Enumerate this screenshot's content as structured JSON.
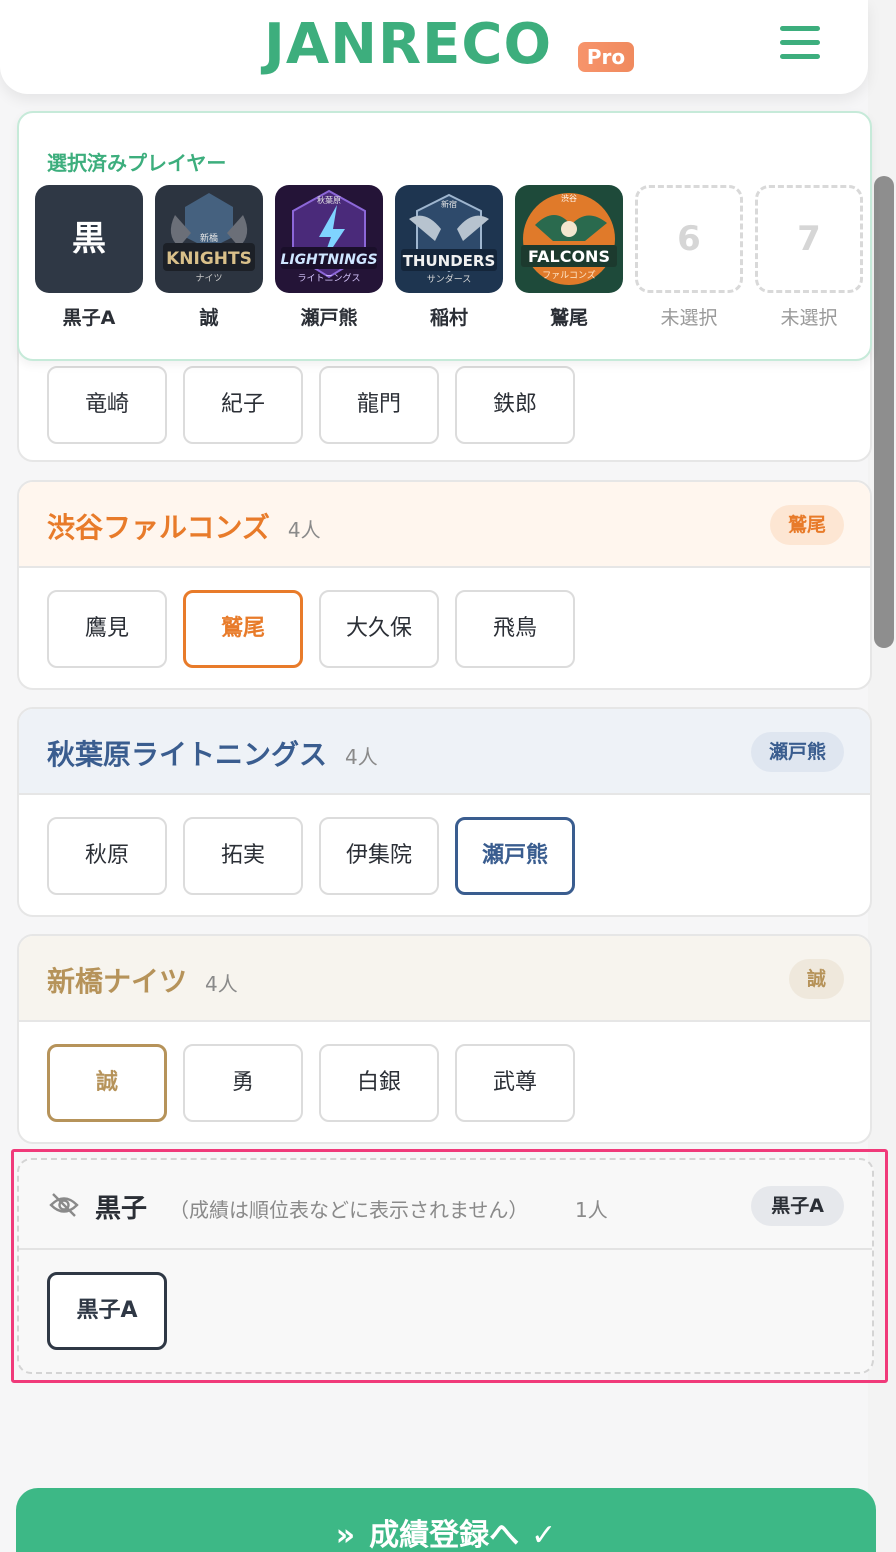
{
  "header": {
    "logo": "JANRECO",
    "badge": "Pro"
  },
  "selected": {
    "title": "選択済みプレイヤー",
    "slots": [
      {
        "name": "黒子A",
        "avatar_text": "黒",
        "avatar_type": "dark-tile"
      },
      {
        "name": "誠",
        "avatar_text": "KNIGHTS",
        "avatar_subtext": "ナイツ",
        "avatar_top": "新橋",
        "color": "#2c3440"
      },
      {
        "name": "瀬戸熊",
        "avatar_text": "LIGHTNINGS",
        "avatar_subtext": "ライトニングス",
        "avatar_top": "秋葉原",
        "color": "#4a2a7a"
      },
      {
        "name": "稲村",
        "avatar_text": "THUNDERS",
        "avatar_subtext": "サンダース",
        "avatar_top": "新宿",
        "color": "#2e4a6b"
      },
      {
        "name": "鷲尾",
        "avatar_text": "FALCONS",
        "avatar_subtext": "ファルコンズ",
        "avatar_top": "渋谷",
        "color": "#e07a2a"
      },
      {
        "name": "未選択",
        "number": "6"
      },
      {
        "name": "未選択",
        "number": "7"
      }
    ]
  },
  "teams": {
    "partial": {
      "players": [
        "竜崎",
        "紀子",
        "龍門",
        "鉄郎"
      ]
    },
    "falcons": {
      "name": "渋谷ファルコンズ",
      "count": "4人",
      "pill": "鷲尾",
      "players": [
        "鷹見",
        "鷲尾",
        "大久保",
        "飛鳥"
      ],
      "accent": "#e87b2a"
    },
    "lightnings": {
      "name": "秋葉原ライトニングス",
      "count": "4人",
      "pill": "瀬戸熊",
      "players": [
        "秋原",
        "拓実",
        "伊集院",
        "瀬戸熊"
      ],
      "accent": "#3a5d8f"
    },
    "knights": {
      "name": "新橋ナイツ",
      "count": "4人",
      "pill": "誠",
      "players": [
        "誠",
        "勇",
        "白銀",
        "武尊"
      ],
      "accent": "#b6935a"
    },
    "kuroko": {
      "name": "黒子",
      "note": "（成績は順位表などに表示されません）",
      "count": "1人",
      "pill": "黒子A",
      "players": [
        "黒子A"
      ]
    }
  },
  "footer": {
    "register_label": "成績登録へ"
  },
  "colors": {
    "brand": "#3dae7d",
    "highlight": "#f03a7a"
  }
}
